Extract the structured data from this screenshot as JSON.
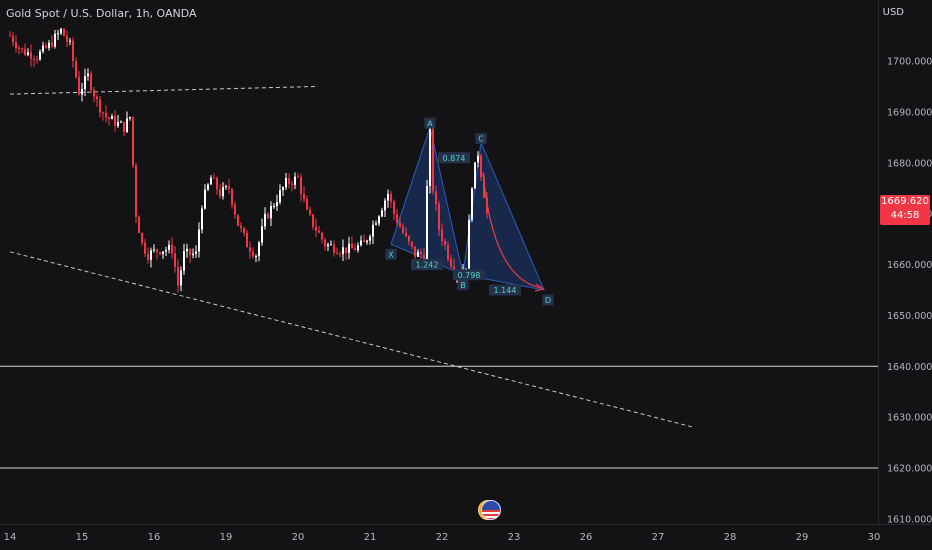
{
  "header": {
    "title": "Gold Spot / U.S. Dollar, 1h, OANDA"
  },
  "axis": {
    "currency": "USD"
  },
  "last_price": {
    "value": "1669.620",
    "countdown": "44:58",
    "color": "#f23645"
  },
  "colors": {
    "up": "#ffffff",
    "down": "#f23645",
    "background": "#131315",
    "pattern_fill": "#1e3b78",
    "pattern_edge": "#2c5bbf",
    "projection": "#e03a4a",
    "label_text": "#4fd1c5",
    "label_bg": "#26324a"
  },
  "icons": {
    "event_marker": "economic-event-flag-icon"
  },
  "chart_data": {
    "type": "candlestick",
    "title": "Gold Spot / U.S. Dollar, 1h, OANDA",
    "ylim": [
      1609,
      1712
    ],
    "y_ticks": [
      "1700.000",
      "1690.000",
      "1680.000",
      "1670.000",
      "1660.000",
      "1650.000",
      "1640.000",
      "1630.000",
      "1620.000",
      "1610.000"
    ],
    "y_tick_values": [
      1700,
      1690,
      1680,
      1670,
      1660,
      1650,
      1640,
      1630,
      1620,
      1610
    ],
    "x_ticks": [
      "14",
      "15",
      "16",
      "19",
      "20",
      "21",
      "22",
      "23",
      "26",
      "27",
      "28",
      "29",
      "30"
    ],
    "x_tick_index": [
      0,
      24,
      48,
      72,
      96,
      120,
      144,
      168,
      192,
      216,
      240,
      264,
      288
    ],
    "candle_anchors": [
      [
        0,
        1705
      ],
      [
        4,
        1702
      ],
      [
        9,
        1701
      ],
      [
        13,
        1703
      ],
      [
        17,
        1706
      ],
      [
        20,
        1703
      ],
      [
        23,
        1694
      ],
      [
        26,
        1697
      ],
      [
        29,
        1692
      ],
      [
        32,
        1689
      ],
      [
        35,
        1688
      ],
      [
        38,
        1687
      ],
      [
        40,
        1689
      ],
      [
        42,
        1670
      ],
      [
        44,
        1664
      ],
      [
        46,
        1662
      ],
      [
        50,
        1663
      ],
      [
        54,
        1663
      ],
      [
        56,
        1656
      ],
      [
        58,
        1662
      ],
      [
        62,
        1662
      ],
      [
        64,
        1672
      ],
      [
        67,
        1677
      ],
      [
        70,
        1674
      ],
      [
        73,
        1675
      ],
      [
        76,
        1668
      ],
      [
        79,
        1664
      ],
      [
        82,
        1662
      ],
      [
        85,
        1669
      ],
      [
        88,
        1672
      ],
      [
        92,
        1676
      ],
      [
        96,
        1677
      ],
      [
        99,
        1670
      ],
      [
        102,
        1667
      ],
      [
        105,
        1664
      ],
      [
        110,
        1663
      ],
      [
        114,
        1663
      ],
      [
        118,
        1664
      ],
      [
        122,
        1669
      ],
      [
        126,
        1674
      ],
      [
        128,
        1670
      ],
      [
        132,
        1665
      ],
      [
        135,
        1662
      ],
      [
        138,
        1662
      ],
      [
        139,
        1675
      ],
      [
        140,
        1686
      ],
      [
        141,
        1675
      ],
      [
        143,
        1667
      ],
      [
        146,
        1662
      ],
      [
        148,
        1659
      ],
      [
        150,
        1658
      ],
      [
        152,
        1660
      ],
      [
        154,
        1676
      ],
      [
        156,
        1682
      ],
      [
        157,
        1678
      ],
      [
        159,
        1670
      ]
    ],
    "lines": [
      {
        "name": "upper-dashed-trendline",
        "style": "dashed",
        "points": [
          [
            0,
            1693.5
          ],
          [
            102,
            1695
          ]
        ]
      },
      {
        "name": "lower-dashed-trendline",
        "style": "dashed",
        "points": [
          [
            0,
            1662.5
          ],
          [
            228,
            1628
          ]
        ]
      },
      {
        "name": "horizontal-level",
        "style": "solid",
        "value": 1640
      },
      {
        "name": "horizontal-level",
        "style": "solid",
        "value": 1620
      }
    ],
    "harmonic_pattern": {
      "points": [
        {
          "label": "X",
          "x": 127,
          "y": 1664
        },
        {
          "label": "A",
          "x": 140,
          "y": 1687
        },
        {
          "label": "B",
          "x": 151,
          "y": 1658
        },
        {
          "label": "C",
          "x": 157,
          "y": 1684
        },
        {
          "label": "D",
          "x": 178,
          "y": 1655
        }
      ],
      "ratios": [
        {
          "label": "0.874",
          "x": 148,
          "y": 1681
        },
        {
          "label": "1.242",
          "x": 139,
          "y": 1660
        },
        {
          "label": "0.798",
          "x": 153,
          "y": 1658
        },
        {
          "label": "1.144",
          "x": 165,
          "y": 1655
        }
      ]
    }
  }
}
